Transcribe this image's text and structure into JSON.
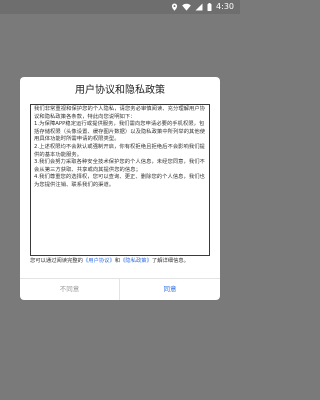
{
  "status_bar": {
    "time": "4:30",
    "icons": [
      "location-icon",
      "wifi-icon",
      "signal-icon",
      "battery-icon"
    ]
  },
  "dialog": {
    "title": "用户协议和隐私政策",
    "policy_text": "我们非常重视和保护您的个人隐私，请您务必审慎阅读、充分理解用户协议和隐私政策各条款，特此向您说明如下：\n1.为保障APP稳定运行或提供服务，我们需向您申请必要的手机权限，包括存储权限（头像设置、缓存图片数据）以及隐私政策中所列举的其他使用具体功能时所需申请的权限类型。\n2.上述权限均不会默认或强制开启，你有权拒绝且拒绝后不会影响我们提供的基本功能服务。\n3.我们会努力采取各种安全技术保护您的个人信息，未经您同意，我们不会从第三方获取、共享或向其提供您的信息；\n4.我们尊重您的选择权，您可以查询、更正、删除您的个人信息，我们也为您提供注销、联系我们的渠道。",
    "agree_prefix": "您可以通过阅读完整的",
    "user_agreement_link": "《用户协议》",
    "and_word": "和",
    "privacy_policy_link": "《隐私政策》",
    "agree_suffix": "了解详细信息。",
    "disagree_label": "不同意",
    "agree_label": "同意"
  },
  "colors": {
    "accent": "#2f6de1",
    "overlay": "#7a7a7a",
    "muted": "#999999"
  }
}
